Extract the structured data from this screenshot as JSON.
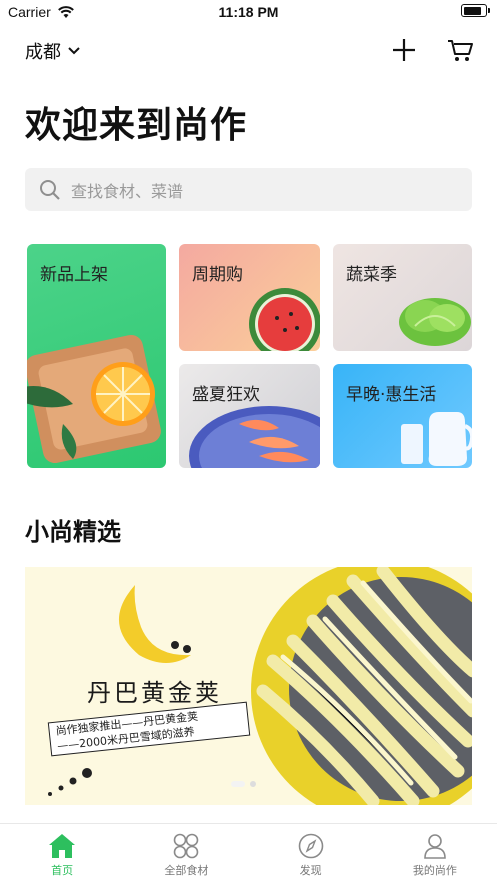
{
  "status": {
    "carrier": "Carrier",
    "time": "11:18 PM",
    "battery_level": 0.85
  },
  "header": {
    "city": "成都"
  },
  "welcome": "欢迎来到尚作",
  "search": {
    "placeholder": "查找食材、菜谱"
  },
  "categories": [
    {
      "label": "新品上架"
    },
    {
      "label": "周期购"
    },
    {
      "label": "蔬菜季"
    },
    {
      "label": "盛夏狂欢"
    },
    {
      "label": "早晚·惠生活"
    }
  ],
  "section": {
    "title": "小尚精选"
  },
  "banner": {
    "name": "丹巴黄金荚",
    "line1": "尚作独家推出——丹巴黄金荚",
    "line2": "——2000米丹巴雪域的滋养"
  },
  "tabs": [
    {
      "label": "首页",
      "icon": "home-icon"
    },
    {
      "label": "全部食材",
      "icon": "grid-icon"
    },
    {
      "label": "发现",
      "icon": "compass-icon"
    },
    {
      "label": "我的尚作",
      "icon": "user-icon"
    }
  ],
  "colors": {
    "accent": "#2dbf5e",
    "green_card": "#2cc871",
    "blue_card": "#38b4f7"
  }
}
